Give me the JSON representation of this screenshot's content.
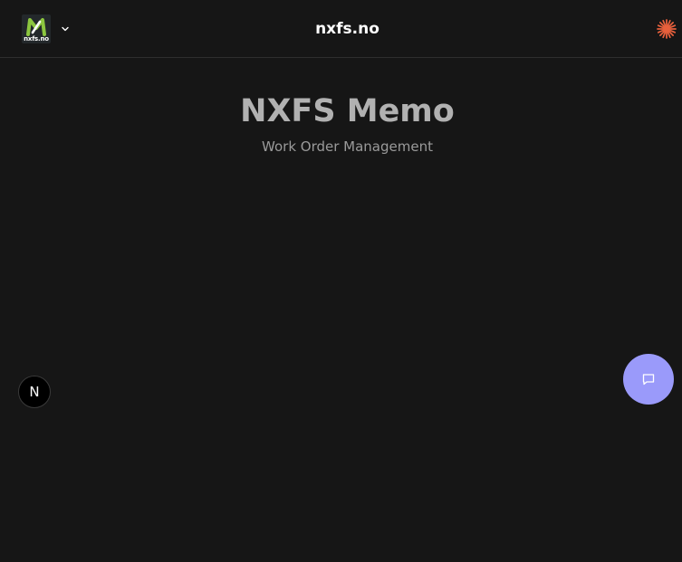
{
  "header": {
    "logo_caption": "nxfs.no",
    "site_title": "nxfs.no",
    "logo_icon": "nxfs-logo",
    "dropdown_icon": "chevron-down-icon",
    "right_icon": "sparkle-icon"
  },
  "hero": {
    "title": "NXFS Memo",
    "subtitle": "Work Order Management"
  },
  "floating": {
    "n_badge_label": "N",
    "chat_icon": "chat-bubble-icon"
  },
  "colors": {
    "background": "#161616",
    "accent": "#9a9afa",
    "spark": "#e8603c",
    "logo_green": "#8cc63f"
  }
}
